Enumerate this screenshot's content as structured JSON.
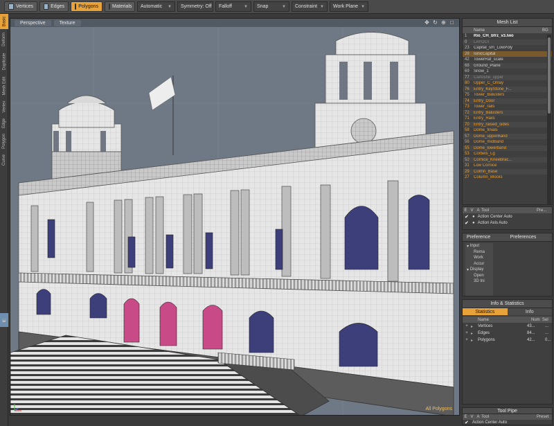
{
  "toolbar": {
    "vertices": "Vertices",
    "edges": "Edges",
    "polygons": "Polygons",
    "materials": "Materials",
    "action_center": "Automatic",
    "symmetry": "Symmetry: Off",
    "falloff": "Falloff",
    "snap": "Snap",
    "constraint": "Constraint",
    "work_plane": "Work Plane"
  },
  "left_tabs": [
    "Basic",
    "Deform",
    "Duplicate",
    "Mesh Edit",
    "Vertex",
    "Edge",
    "Polygon",
    "Curve"
  ],
  "viewport": {
    "tabs": [
      "Perspective",
      "Texture"
    ],
    "status": "All Polygons",
    "icons": [
      "move-icon",
      "rotate-icon",
      "zoom-icon",
      "maximize-icon"
    ]
  },
  "mesh_list": {
    "title": "Mesh List",
    "col_name": "Name",
    "col_bg": "BG",
    "rows": [
      {
        "n": "1",
        "name": "Rio_CH_bfrz_v3.lwo",
        "style": "bold"
      },
      {
        "n": "0",
        "name": "LAYOUT",
        "style": "dim"
      },
      {
        "n": "23",
        "name": "Capital_sm_LowPoly",
        "style": ""
      },
      {
        "n": "28",
        "name": "IonicCapital",
        "style": "hl"
      },
      {
        "n": "42",
        "name": "TowerRaf_scale",
        "style": ""
      },
      {
        "n": "68",
        "name": "Ground_Plane",
        "style": ""
      },
      {
        "n": "69",
        "name": "Snow_1",
        "style": ""
      },
      {
        "n": "77",
        "name": "Cartoshe_upper",
        "style": "dim"
      },
      {
        "n": "80",
        "name": "Upper_C_Onlay",
        "style": "orange"
      },
      {
        "n": "76",
        "name": "Entry_KeyStone_F...",
        "style": "orange"
      },
      {
        "n": "75",
        "name": "Tower_Balusters",
        "style": "orange"
      },
      {
        "n": "74",
        "name": "Entry_Door",
        "style": "orange"
      },
      {
        "n": "73",
        "name": "Tower_rails",
        "style": "orange"
      },
      {
        "n": "72",
        "name": "Entry_Balusters",
        "style": "orange"
      },
      {
        "n": "71",
        "name": "Entry_Rails",
        "style": "orange"
      },
      {
        "n": "70",
        "name": "Entry_raised_sides",
        "style": "orange"
      },
      {
        "n": "58",
        "name": "Dome_finials",
        "style": "orange"
      },
      {
        "n": "57",
        "name": "Dome_upperBand",
        "style": "orange"
      },
      {
        "n": "56",
        "name": "Dome_midBand",
        "style": "orange"
      },
      {
        "n": "55",
        "name": "Dome_lowerband",
        "style": "orange"
      },
      {
        "n": "53",
        "name": "Corbels_Lg",
        "style": "orange"
      },
      {
        "n": "52",
        "name": "Cornice_KneeBrac...",
        "style": "orange"
      },
      {
        "n": "31",
        "name": "Low Cornice",
        "style": "orange"
      },
      {
        "n": "29",
        "name": "Colmn_Base",
        "style": "orange"
      },
      {
        "n": "27",
        "name": "Column_Blocks",
        "style": "orange"
      }
    ]
  },
  "tool_panel": {
    "col_e": "E",
    "col_v": "V",
    "col_a": "A",
    "col_tool": "Tool",
    "col_pre": "Pre...",
    "rows": [
      "Action Center Auto",
      "Action Axis Auto"
    ]
  },
  "preferences": {
    "title_left": "Preference",
    "title_right": "Preferences",
    "tree": [
      "Input",
      "Rema",
      "Work",
      "Accur",
      "Display",
      "Open",
      "3D Ini"
    ]
  },
  "info_stats": {
    "title": "Info & Statistics",
    "tab_statistics": "Statistics",
    "tab_info": "Info",
    "col_name": "Name",
    "col_num": "Num",
    "col_sel": "Sel",
    "rows": [
      {
        "name": "Vertices",
        "num": "43...",
        "sel": "..."
      },
      {
        "name": "Edges",
        "num": "84...",
        "sel": "..."
      },
      {
        "name": "Polygons",
        "num": "42...",
        "sel": "0..."
      }
    ]
  },
  "tool_pipe": {
    "title": "Tool Pipe",
    "col_e": "E",
    "col_v": "V",
    "col_a": "A",
    "col_tool": "Tool",
    "col_preset": "Preset",
    "row": "Action Center Auto"
  },
  "colors": {
    "accent": "#e8a23a",
    "viewport_bg": "#6f7885",
    "mesh_item": "#f0a030",
    "door_highlight": "#c84a86",
    "window_blue": "#3c3f7a"
  }
}
